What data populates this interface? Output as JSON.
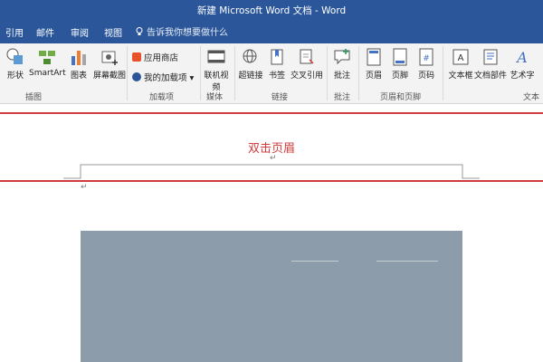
{
  "app": {
    "title": "新建 Microsoft Word 文档 - Word"
  },
  "tabs": [
    "引用",
    "邮件",
    "审阅",
    "视图"
  ],
  "tell_me": "告诉我你想要做什么",
  "ribbon": {
    "insert_illustrations": {
      "shapes": "形状",
      "smartart": "SmartArt",
      "chart": "图表",
      "screenshot": "屏幕截图",
      "group": "插图"
    },
    "addins": {
      "store": "应用商店",
      "my_addins": "我的加载项",
      "group": "加载项"
    },
    "media": {
      "online_video": "联机视频",
      "group": "媒体"
    },
    "links": {
      "hyperlink": "超链接",
      "bookmark": "书签",
      "crossref": "交叉引用",
      "group": "链接"
    },
    "comments": {
      "comment": "批注",
      "group": "批注"
    },
    "header_footer": {
      "header": "页眉",
      "footer": "页脚",
      "page_number": "页码",
      "group": "页眉和页脚"
    },
    "text": {
      "textbox": "文本框",
      "quickparts": "文档部件",
      "wordart": "艺术字",
      "group": "文本"
    }
  },
  "document": {
    "header_hint": "双击页眉",
    "pilcrow": "↵"
  },
  "colors": {
    "titlebar": "#2b579a",
    "header_border": "#d23c3c",
    "image": "#8d9caa"
  }
}
